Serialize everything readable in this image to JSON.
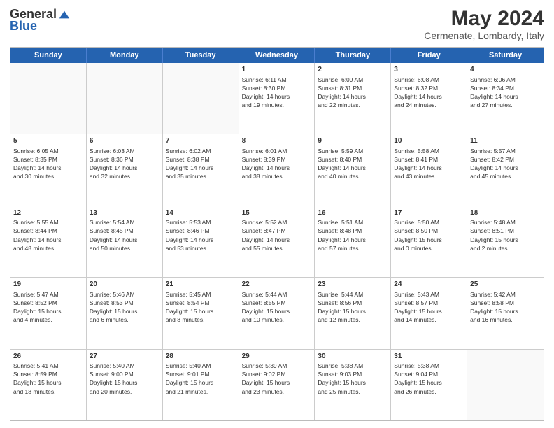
{
  "header": {
    "logo_general": "General",
    "logo_blue": "Blue",
    "month_title": "May 2024",
    "location": "Cermenate, Lombardy, Italy"
  },
  "calendar": {
    "days_of_week": [
      "Sunday",
      "Monday",
      "Tuesday",
      "Wednesday",
      "Thursday",
      "Friday",
      "Saturday"
    ],
    "weeks": [
      [
        {
          "day": "",
          "text": ""
        },
        {
          "day": "",
          "text": ""
        },
        {
          "day": "",
          "text": ""
        },
        {
          "day": "1",
          "text": "Sunrise: 6:11 AM\nSunset: 8:30 PM\nDaylight: 14 hours\nand 19 minutes."
        },
        {
          "day": "2",
          "text": "Sunrise: 6:09 AM\nSunset: 8:31 PM\nDaylight: 14 hours\nand 22 minutes."
        },
        {
          "day": "3",
          "text": "Sunrise: 6:08 AM\nSunset: 8:32 PM\nDaylight: 14 hours\nand 24 minutes."
        },
        {
          "day": "4",
          "text": "Sunrise: 6:06 AM\nSunset: 8:34 PM\nDaylight: 14 hours\nand 27 minutes."
        }
      ],
      [
        {
          "day": "5",
          "text": "Sunrise: 6:05 AM\nSunset: 8:35 PM\nDaylight: 14 hours\nand 30 minutes."
        },
        {
          "day": "6",
          "text": "Sunrise: 6:03 AM\nSunset: 8:36 PM\nDaylight: 14 hours\nand 32 minutes."
        },
        {
          "day": "7",
          "text": "Sunrise: 6:02 AM\nSunset: 8:38 PM\nDaylight: 14 hours\nand 35 minutes."
        },
        {
          "day": "8",
          "text": "Sunrise: 6:01 AM\nSunset: 8:39 PM\nDaylight: 14 hours\nand 38 minutes."
        },
        {
          "day": "9",
          "text": "Sunrise: 5:59 AM\nSunset: 8:40 PM\nDaylight: 14 hours\nand 40 minutes."
        },
        {
          "day": "10",
          "text": "Sunrise: 5:58 AM\nSunset: 8:41 PM\nDaylight: 14 hours\nand 43 minutes."
        },
        {
          "day": "11",
          "text": "Sunrise: 5:57 AM\nSunset: 8:42 PM\nDaylight: 14 hours\nand 45 minutes."
        }
      ],
      [
        {
          "day": "12",
          "text": "Sunrise: 5:55 AM\nSunset: 8:44 PM\nDaylight: 14 hours\nand 48 minutes."
        },
        {
          "day": "13",
          "text": "Sunrise: 5:54 AM\nSunset: 8:45 PM\nDaylight: 14 hours\nand 50 minutes."
        },
        {
          "day": "14",
          "text": "Sunrise: 5:53 AM\nSunset: 8:46 PM\nDaylight: 14 hours\nand 53 minutes."
        },
        {
          "day": "15",
          "text": "Sunrise: 5:52 AM\nSunset: 8:47 PM\nDaylight: 14 hours\nand 55 minutes."
        },
        {
          "day": "16",
          "text": "Sunrise: 5:51 AM\nSunset: 8:48 PM\nDaylight: 14 hours\nand 57 minutes."
        },
        {
          "day": "17",
          "text": "Sunrise: 5:50 AM\nSunset: 8:50 PM\nDaylight: 15 hours\nand 0 minutes."
        },
        {
          "day": "18",
          "text": "Sunrise: 5:48 AM\nSunset: 8:51 PM\nDaylight: 15 hours\nand 2 minutes."
        }
      ],
      [
        {
          "day": "19",
          "text": "Sunrise: 5:47 AM\nSunset: 8:52 PM\nDaylight: 15 hours\nand 4 minutes."
        },
        {
          "day": "20",
          "text": "Sunrise: 5:46 AM\nSunset: 8:53 PM\nDaylight: 15 hours\nand 6 minutes."
        },
        {
          "day": "21",
          "text": "Sunrise: 5:45 AM\nSunset: 8:54 PM\nDaylight: 15 hours\nand 8 minutes."
        },
        {
          "day": "22",
          "text": "Sunrise: 5:44 AM\nSunset: 8:55 PM\nDaylight: 15 hours\nand 10 minutes."
        },
        {
          "day": "23",
          "text": "Sunrise: 5:44 AM\nSunset: 8:56 PM\nDaylight: 15 hours\nand 12 minutes."
        },
        {
          "day": "24",
          "text": "Sunrise: 5:43 AM\nSunset: 8:57 PM\nDaylight: 15 hours\nand 14 minutes."
        },
        {
          "day": "25",
          "text": "Sunrise: 5:42 AM\nSunset: 8:58 PM\nDaylight: 15 hours\nand 16 minutes."
        }
      ],
      [
        {
          "day": "26",
          "text": "Sunrise: 5:41 AM\nSunset: 8:59 PM\nDaylight: 15 hours\nand 18 minutes."
        },
        {
          "day": "27",
          "text": "Sunrise: 5:40 AM\nSunset: 9:00 PM\nDaylight: 15 hours\nand 20 minutes."
        },
        {
          "day": "28",
          "text": "Sunrise: 5:40 AM\nSunset: 9:01 PM\nDaylight: 15 hours\nand 21 minutes."
        },
        {
          "day": "29",
          "text": "Sunrise: 5:39 AM\nSunset: 9:02 PM\nDaylight: 15 hours\nand 23 minutes."
        },
        {
          "day": "30",
          "text": "Sunrise: 5:38 AM\nSunset: 9:03 PM\nDaylight: 15 hours\nand 25 minutes."
        },
        {
          "day": "31",
          "text": "Sunrise: 5:38 AM\nSunset: 9:04 PM\nDaylight: 15 hours\nand 26 minutes."
        },
        {
          "day": "",
          "text": ""
        }
      ]
    ]
  }
}
